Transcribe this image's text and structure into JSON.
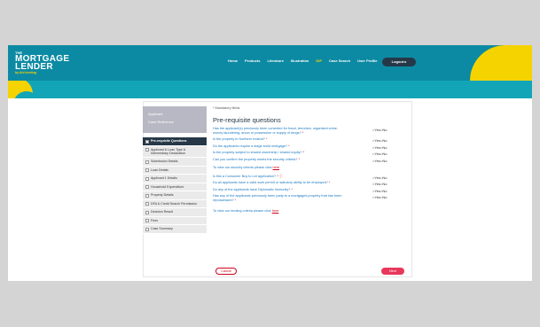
{
  "brand": {
    "the": "THE",
    "name_line1": "MORTGAGE",
    "name_line2": "LENDER",
    "sub": "by Ahi lending"
  },
  "nav": {
    "items": [
      "Home",
      "Products",
      "Literature",
      "Illustration",
      "DIP",
      "Case Search",
      "User Profile"
    ],
    "highlight_index": 4,
    "logout": "Logout ▸"
  },
  "sidebar": {
    "applicant_label": "Applicant",
    "case_ref_label": "Case Reference",
    "items": [
      "Pre-requisite Questions",
      "Applicant & Loan Type & Intermediary Declaration",
      "Submission Details",
      "Loan Details",
      "Applicant 1 Details",
      "Household Expenditure",
      "Property Details",
      "DFA & Credit Search Permission",
      "Decision Result",
      "Fees",
      "Case Summary"
    ],
    "active_index": 0
  },
  "main": {
    "mandatory_note": "* Mandatory fields",
    "title": "Pre-requisite questions",
    "questions_a": [
      {
        "text": "Has the applicant(s) previously been convicted for fraud, terrorism, organised crime, money laundering, arson or possession or supply of drugs?",
        "req": "*"
      },
      {
        "text": "Is the property in Northern Ireland?",
        "req": "*"
      },
      {
        "text": "Do the applicants require a stage build mortgage?",
        "req": "*"
      },
      {
        "text": "Is the property subject to shared ownership / shared equity?",
        "req": "*"
      },
      {
        "text": "Can you confirm the property meets the security criteria?",
        "req": "*"
      }
    ],
    "security_link_text": "To view our security criteria please click",
    "questions_b": [
      {
        "text": "Is this a Consumer Buy to Let application?",
        "req": "*  ⓘ"
      },
      {
        "text": "Do all applicants have a valid work permit or statutory ability to be employed?",
        "req": "*"
      },
      {
        "text": "Do any of the applicants have Diplomatic Immunity?",
        "req": "*"
      },
      {
        "text": "Has any of the applicants previously been party to a mortgaged property that has been repossessed?",
        "req": "*"
      }
    ],
    "lending_link_text": "To view our lending criteria please click",
    "here": "here",
    "yes": "Yes",
    "no": "No",
    "cancel": "Cancel",
    "next": "Next"
  },
  "colors": {
    "teal": "#0d8aa3",
    "yellow": "#f5d300",
    "navy": "#263848",
    "red": "#e8375b"
  }
}
